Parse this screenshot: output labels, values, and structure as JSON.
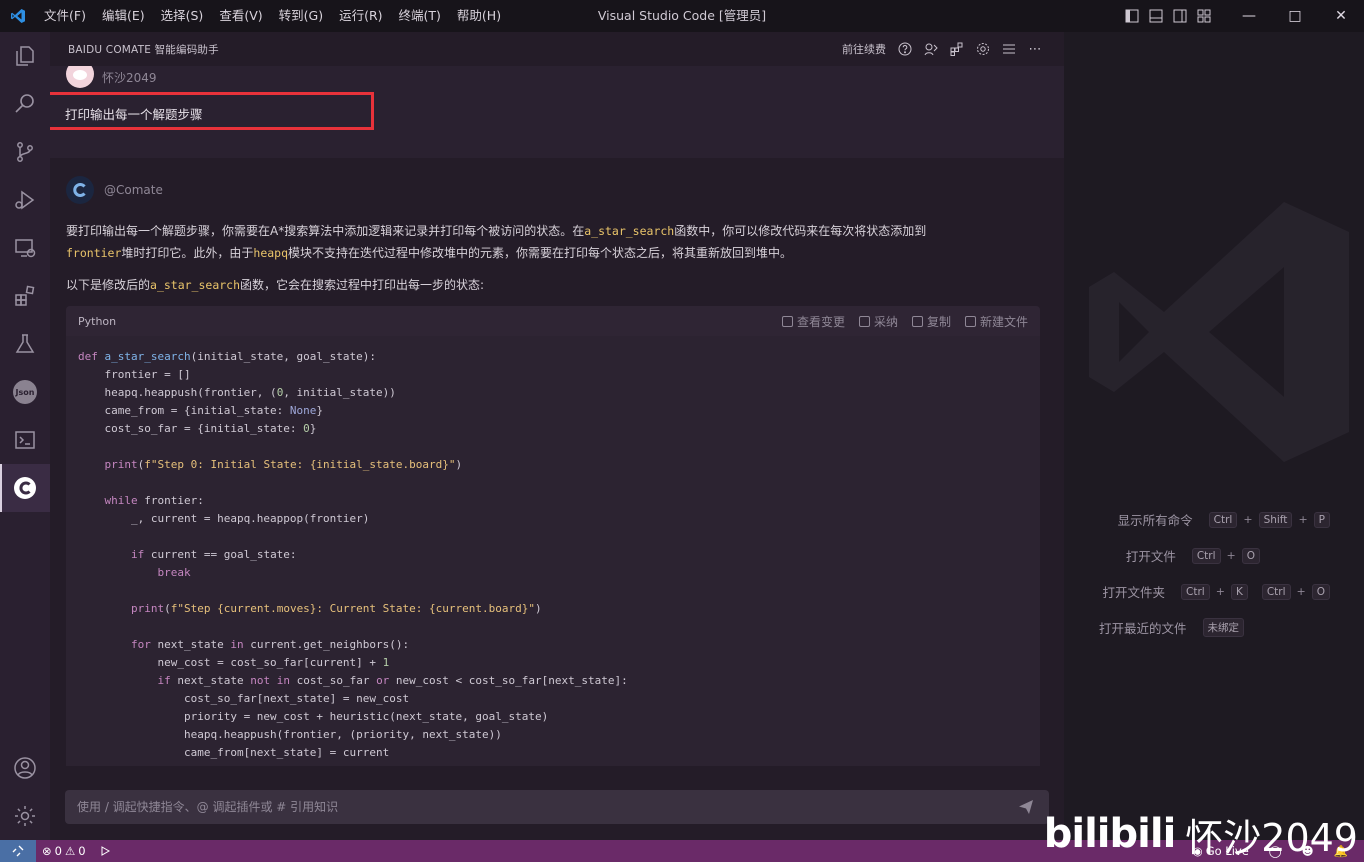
{
  "window": {
    "title": "Visual Studio Code [管理员]",
    "menu": [
      "文件(F)",
      "编辑(E)",
      "选择(S)",
      "查看(V)",
      "转到(G)",
      "运行(R)",
      "终端(T)",
      "帮助(H)"
    ]
  },
  "activity_bar": {
    "icons": [
      "explorer-icon",
      "search-icon",
      "source-control-icon",
      "run-debug-icon",
      "remote-explorer-icon",
      "extensions-icon",
      "testing-icon",
      "json-icon",
      "terminal-icon",
      "comate-icon"
    ],
    "bottom_icons": [
      "account-icon",
      "settings-gear-icon"
    ],
    "json_label": "Json"
  },
  "panel": {
    "title": "BAIDU COMATE 智能编码助手",
    "goto_renew": "前往续费"
  },
  "user_message": {
    "name": "怀沙2049",
    "text": "打印输出每一个解题步骤"
  },
  "bot_message": {
    "name": "@Comate",
    "para1_a": "要打印输出每一个解题步骤，你需要在A*搜索算法中添加逻辑来记录并打印每个被访问的状态。在",
    "para1_code1": "a_star_search",
    "para1_b": "函数中，你可以修改代码来在每次将状态添加到",
    "para1_code2": "frontier",
    "para1_c": "堆时打印它。此外，由于",
    "para1_code3": "heapq",
    "para1_d": "模块不支持在迭代过程中修改堆中的元素，你需要在打印每个状态之后，将其重新放回到堆中。",
    "para2_a": "以下是修改后的",
    "para2_code": "a_star_search",
    "para2_b": "函数，它会在搜索过程中打印出每一步的状态:",
    "code_lang": "Python",
    "code_actions": [
      "查看变更",
      "采纳",
      "复制",
      "新建文件"
    ]
  },
  "chat_input": {
    "placeholder": "使用 / 调起快捷指令、@ 调起插件或 # 引用知识"
  },
  "shortcuts": [
    {
      "label": "显示所有命令",
      "keys": [
        "Ctrl",
        "+",
        "Shift",
        "+",
        "P"
      ]
    },
    {
      "label": "打开文件",
      "keys": [
        "Ctrl",
        "+",
        "O"
      ]
    },
    {
      "label": "打开文件夹",
      "keys": [
        "Ctrl",
        "+",
        "K",
        "Ctrl",
        "+",
        "O"
      ]
    },
    {
      "label": "打开最近的文件",
      "keys": [
        "未绑定"
      ]
    }
  ],
  "status_bar": {
    "errors": "0",
    "warnings": "0",
    "go_live": "Go Live"
  },
  "watermark": {
    "logo": "bilibili",
    "user": "怀沙2049"
  },
  "colors": {
    "status_bar": "#6a2a68",
    "highlight_box": "#e8323a",
    "vs_blue": "#2e8fe3"
  }
}
